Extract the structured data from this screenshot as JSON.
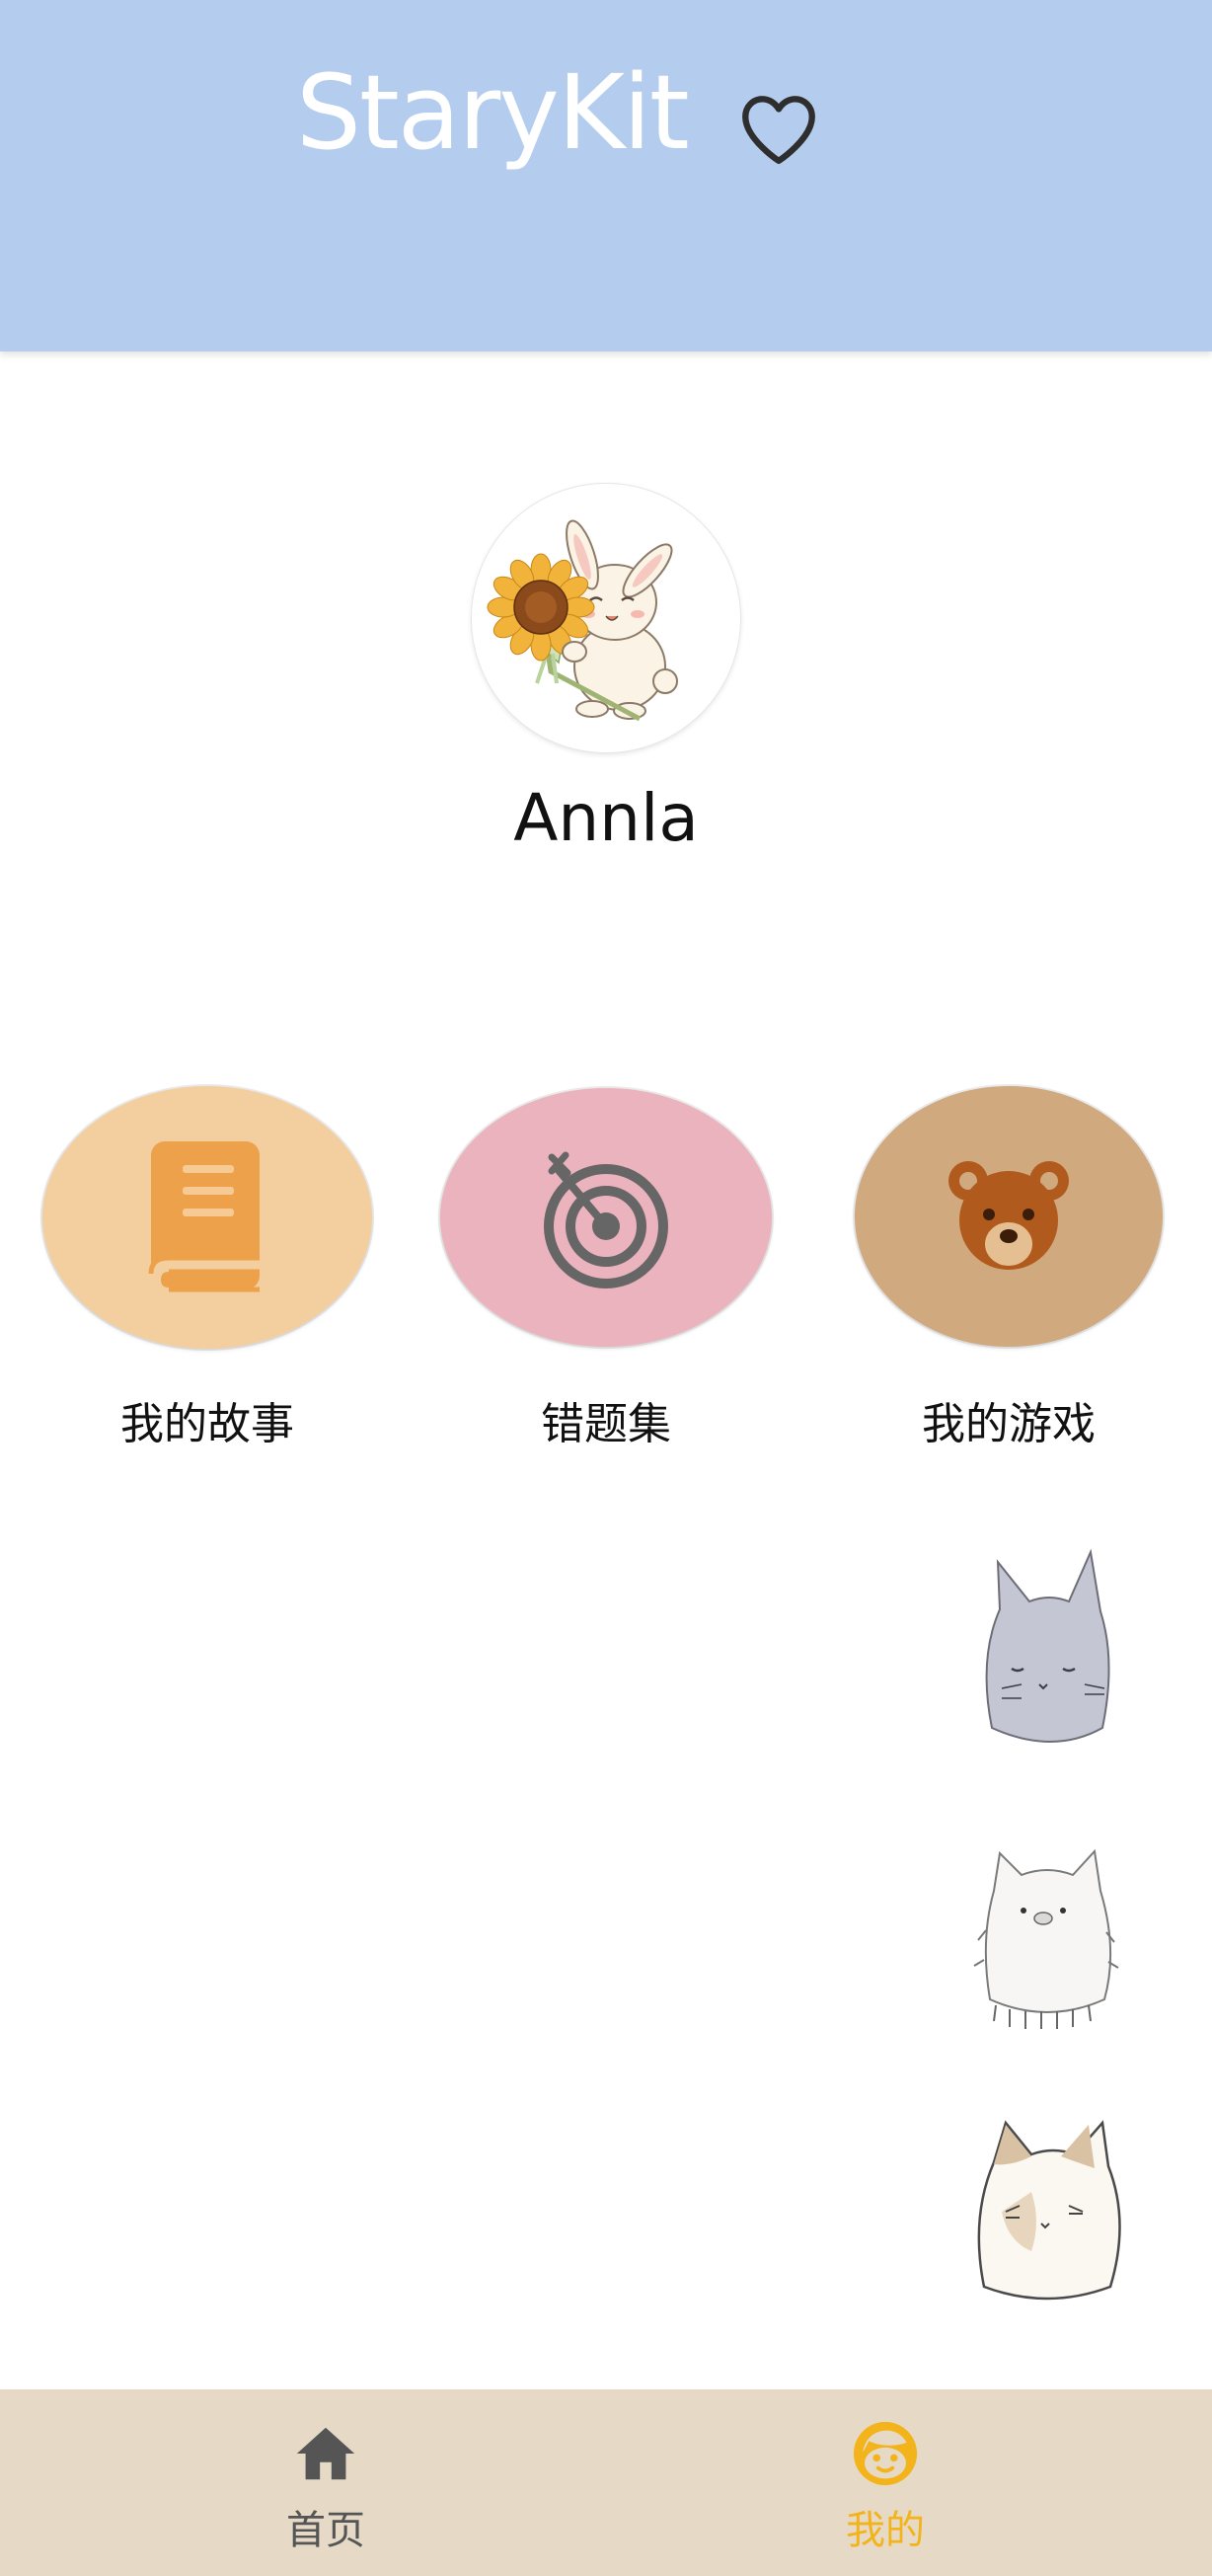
{
  "header": {
    "title": "StaryKit",
    "background": "#b4cdee",
    "favorite_icon": "heart-outline-icon"
  },
  "profile": {
    "avatar_icon": "bunny-with-sunflower-avatar",
    "username": "Annla"
  },
  "features": [
    {
      "label": "我的故事",
      "icon": "book-icon",
      "color": "#f3cfa0"
    },
    {
      "label": "错题集",
      "icon": "target-icon",
      "color": "#ebb3bd"
    },
    {
      "label": "我的游戏",
      "icon": "bear-icon",
      "color": "#d0a97f"
    }
  ],
  "decorations": [
    {
      "icon": "grey-cat-icon"
    },
    {
      "icon": "white-fluffy-cat-icon"
    },
    {
      "icon": "calico-cat-icon"
    }
  ],
  "bottom_nav": {
    "background": "#e6dac7",
    "items": [
      {
        "label": "首页",
        "icon": "home-icon",
        "active": false,
        "color": "#555555"
      },
      {
        "label": "我的",
        "icon": "face-icon",
        "active": true,
        "color": "#f3b31a"
      }
    ]
  }
}
